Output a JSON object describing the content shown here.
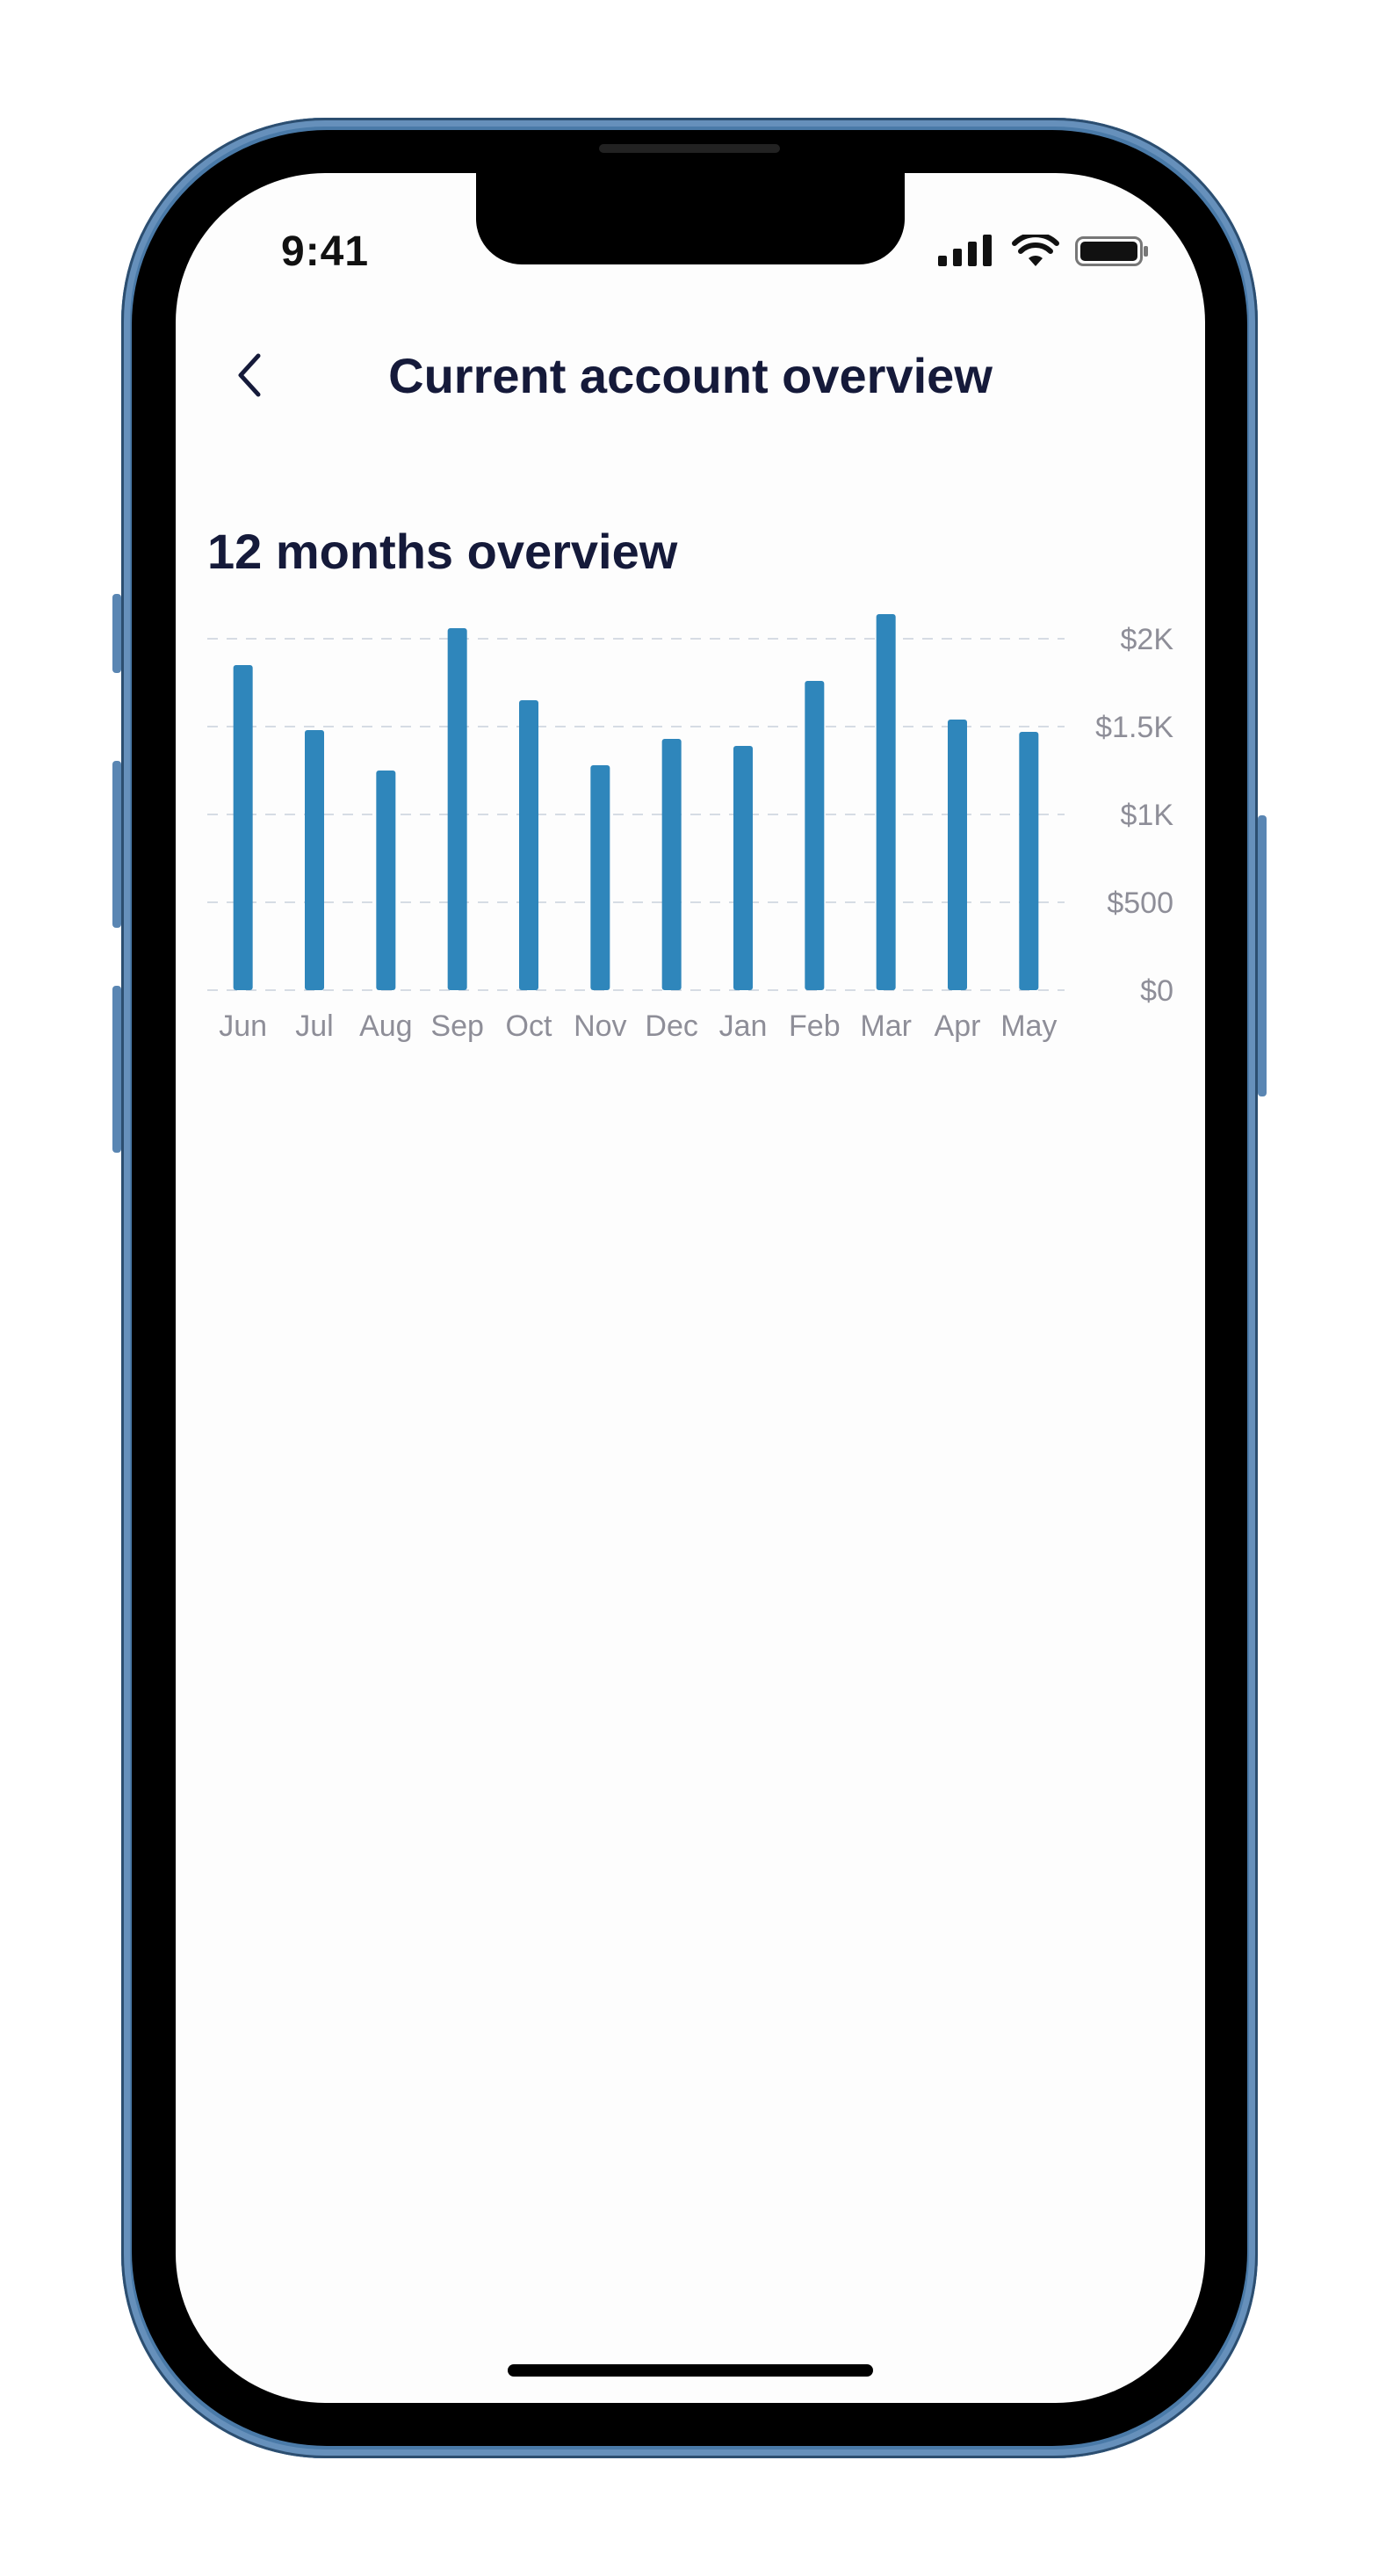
{
  "status_bar": {
    "time": "9:41"
  },
  "nav": {
    "title": "Current account overview"
  },
  "section": {
    "title": "12 months overview"
  },
  "colors": {
    "bar": "#2f86bb",
    "bar_highlight": "#1a96d6",
    "grid": "#d6dce4",
    "label": "#8e8e98",
    "title": "#151a3a"
  },
  "chart_data": {
    "type": "bar",
    "title": "12 months overview",
    "categories": [
      "Jun",
      "Jul",
      "Aug",
      "Sep",
      "Oct",
      "Nov",
      "Dec",
      "Jan",
      "Feb",
      "Mar",
      "Apr",
      "May"
    ],
    "values": [
      1850,
      1480,
      1250,
      2060,
      1650,
      1280,
      1430,
      1390,
      1760,
      2140,
      1540,
      1470
    ],
    "ylim": [
      0,
      2000
    ],
    "y_ticks": [
      0,
      500,
      1000,
      1500,
      2000
    ],
    "y_tick_labels": [
      "$0",
      "$500",
      "$1K",
      "$1.5K",
      "$2K"
    ],
    "y_axis_side": "right",
    "grid": true,
    "xlabel": "",
    "ylabel": ""
  }
}
